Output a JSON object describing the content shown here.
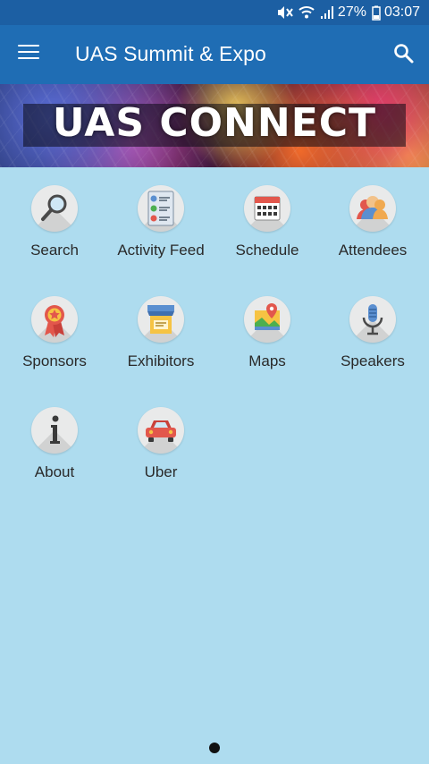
{
  "status_bar": {
    "battery": "27%",
    "time": "03:07",
    "icons": [
      "mute-icon",
      "wifi-icon",
      "signal-icon",
      "battery-icon"
    ]
  },
  "app_bar": {
    "title": "UAS Summit & Expo",
    "menu_icon": "hamburger-menu-icon",
    "search_icon": "search-icon",
    "color": "#1f6db4"
  },
  "banner": {
    "text": "UAS CONNECT"
  },
  "tiles": [
    {
      "label": "Search",
      "icon": "search-icon"
    },
    {
      "label": "Activity Feed",
      "icon": "activity-feed-icon"
    },
    {
      "label": "Schedule",
      "icon": "calendar-icon"
    },
    {
      "label": "Attendees",
      "icon": "attendees-icon"
    },
    {
      "label": "Sponsors",
      "icon": "award-ribbon-icon"
    },
    {
      "label": "Exhibitors",
      "icon": "booth-icon"
    },
    {
      "label": "Maps",
      "icon": "map-pin-icon"
    },
    {
      "label": "Speakers",
      "icon": "microphone-icon"
    },
    {
      "label": "About",
      "icon": "info-icon"
    },
    {
      "label": "Uber",
      "icon": "car-icon"
    }
  ],
  "pager": {
    "pages": 1,
    "current": 1
  },
  "colors": {
    "background": "#aedcef",
    "status_bar": "#1c5fa3"
  }
}
